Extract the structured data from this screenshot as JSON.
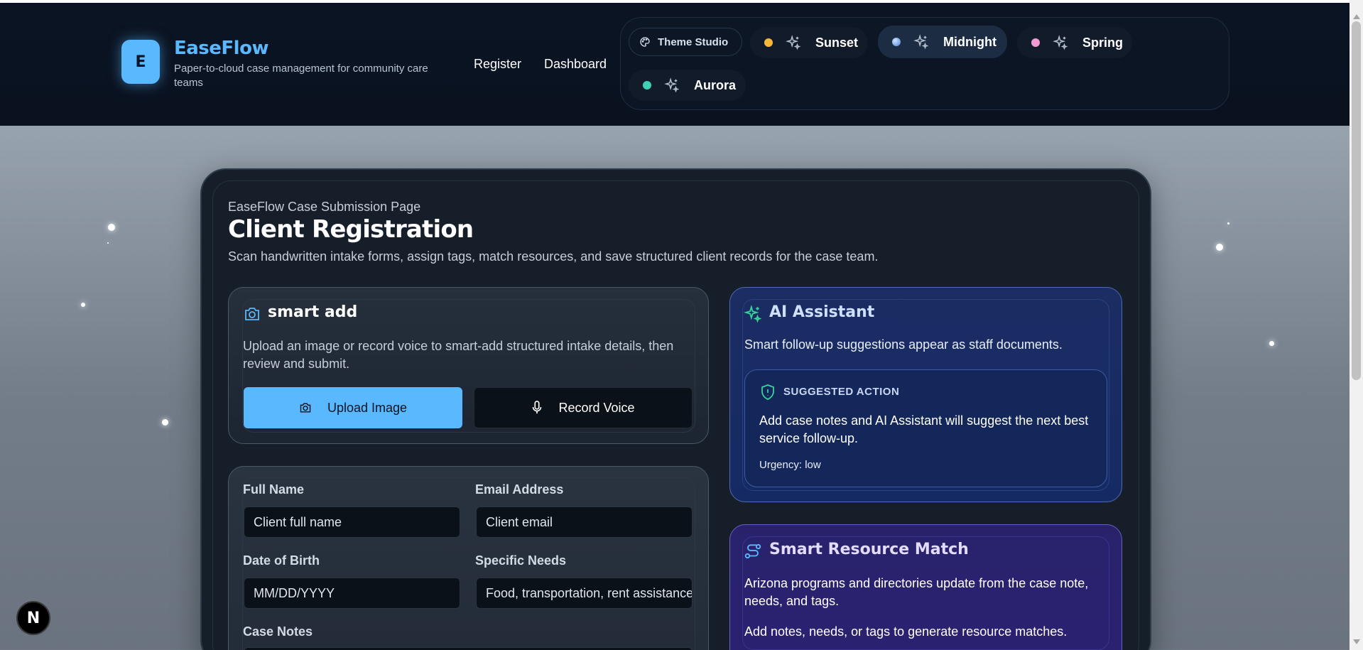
{
  "brand": {
    "logo_letter": "E",
    "title": "EaseFlow",
    "subtitle": "Paper-to-cloud case management for community care teams"
  },
  "nav": {
    "register": "Register",
    "dashboard": "Dashboard"
  },
  "themes": {
    "studio_label": "Theme Studio",
    "options": [
      {
        "label": "Sunset",
        "color": "#f5b83d",
        "active": false
      },
      {
        "label": "Midnight",
        "color": "#6aa2ff",
        "active": true
      },
      {
        "label": "Spring",
        "color": "#f29bd3",
        "active": false
      },
      {
        "label": "Aurora",
        "color": "#3fd0b6",
        "active": false
      }
    ]
  },
  "page": {
    "kicker": "EaseFlow Case Submission Page",
    "title": "Client Registration",
    "description": "Scan handwritten intake forms, assign tags, match resources, and save structured client records for the case team."
  },
  "smart_add": {
    "title": "smart add",
    "description": "Upload an image or record voice to smart-add structured intake details, then review and submit.",
    "upload_label": "Upload Image",
    "voice_label": "Record Voice"
  },
  "form": {
    "full_name": {
      "label": "Full Name",
      "placeholder": "Client full name"
    },
    "email": {
      "label": "Email Address",
      "placeholder": "Client email"
    },
    "dob": {
      "label": "Date of Birth",
      "placeholder": "MM/DD/YYYY"
    },
    "needs": {
      "label": "Specific Needs",
      "placeholder": "Food, transportation, rent assistance"
    },
    "case_notes": {
      "label": "Case Notes"
    }
  },
  "ai_assistant": {
    "title": "AI Assistant",
    "description": "Smart follow-up suggestions appear as staff documents.",
    "suggested_label": "SUGGESTED ACTION",
    "suggested_text": "Add case notes and AI Assistant will suggest the next best service follow-up.",
    "urgency": "Urgency: low"
  },
  "resource_match": {
    "title": "Smart Resource Match",
    "description": "Arizona programs and directories update from the case note, needs, and tags.",
    "empty_text": "Add notes, needs, or tags to generate resource matches."
  },
  "badge": {
    "label": "N"
  },
  "colors": {
    "accent": "#5ab8ff",
    "header_bg": "#0b1422",
    "ai_panel": "#1b2d63",
    "resource_panel": "#29226b"
  }
}
